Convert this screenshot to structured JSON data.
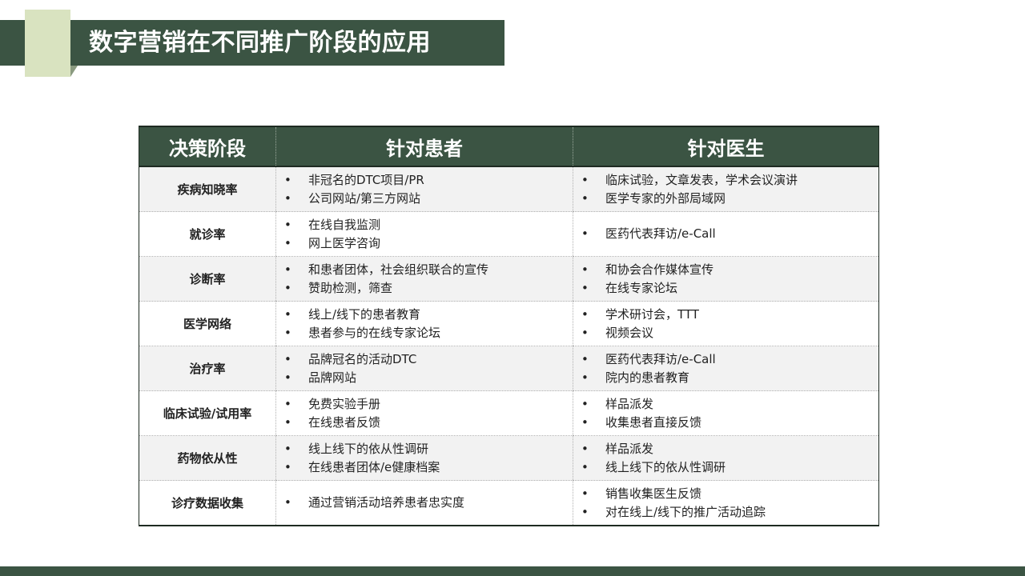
{
  "title": "数字营销在不同推广阶段的应用",
  "table": {
    "headers": [
      "决策阶段",
      "针对患者",
      "针对医生"
    ],
    "bullet": "•",
    "rows": [
      {
        "stage": "疾病知晓率",
        "patient": [
          "非冠名的DTC项目/PR",
          "公司网站/第三方网站"
        ],
        "doctor": [
          "临床试验，文章发表，学术会议演讲",
          "医学专家的外部局域网"
        ]
      },
      {
        "stage": "就诊率",
        "patient": [
          "在线自我监测",
          "网上医学咨询"
        ],
        "doctor": [
          "医药代表拜访/e-Call"
        ]
      },
      {
        "stage": "诊断率",
        "patient": [
          "和患者团体，社会组织联合的宣传",
          "赞助检测，筛查"
        ],
        "doctor": [
          "和协会合作媒体宣传",
          "在线专家论坛"
        ]
      },
      {
        "stage": "医学网络",
        "patient": [
          "线上/线下的患者教育",
          "患者参与的在线专家论坛"
        ],
        "doctor": [
          "学术研讨会，TTT",
          "视频会议"
        ]
      },
      {
        "stage": "治疗率",
        "patient": [
          "品牌冠名的活动DTC",
          "品牌网站"
        ],
        "doctor": [
          "医药代表拜访/e-Call",
          "院内的患者教育"
        ]
      },
      {
        "stage": "临床试验/试用率",
        "patient": [
          "免费实验手册",
          "在线患者反馈"
        ],
        "doctor": [
          "样品派发",
          "收集患者直接反馈"
        ]
      },
      {
        "stage": "药物依从性",
        "patient": [
          "线上线下的依从性调研",
          "在线患者团体/e健康档案"
        ],
        "doctor": [
          "样品派发",
          "线上线下的依从性调研"
        ]
      },
      {
        "stage": "诊疗数据收集",
        "patient": [
          "通过营销活动培养患者忠实度"
        ],
        "doctor": [
          "销售收集医生反馈",
          "对在线上/线下的推广活动追踪"
        ]
      }
    ]
  }
}
